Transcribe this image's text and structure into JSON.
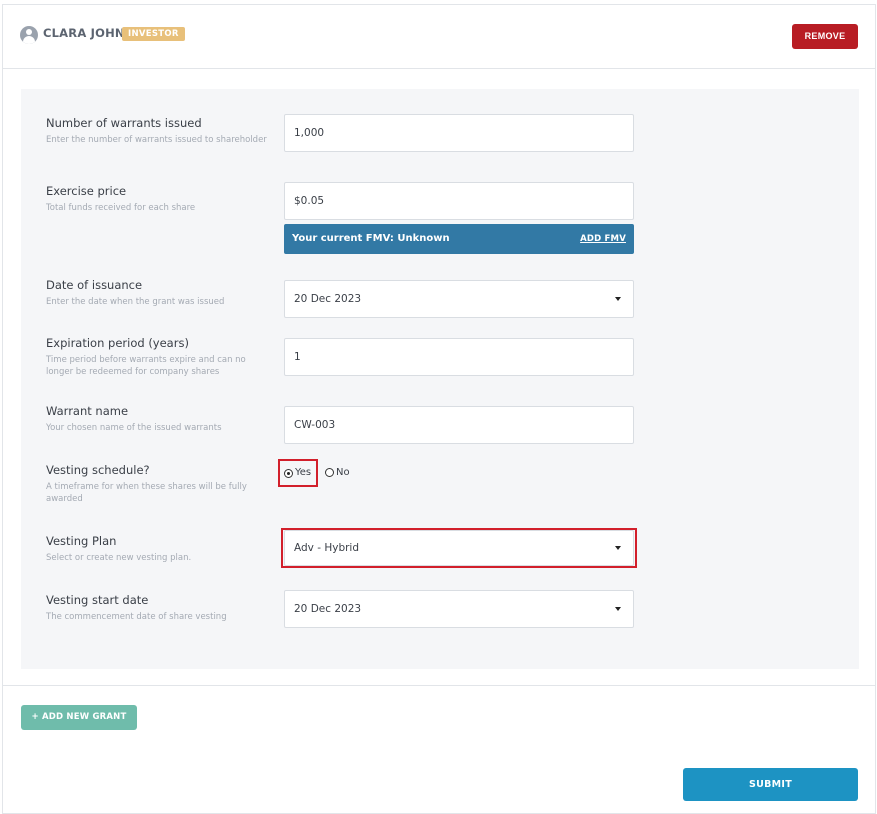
{
  "header": {
    "name": "CLARA JOHN",
    "badge": "INVESTOR",
    "remove_label": "REMOVE"
  },
  "form": {
    "warrants": {
      "label": "Number of warrants issued",
      "help": "Enter the number of warrants issued to shareholder",
      "value": "1,000"
    },
    "exercise_price": {
      "label": "Exercise price",
      "help": "Total funds received for each share",
      "value": "$0.05"
    },
    "fmv": {
      "text": "Your current FMV: Unknown",
      "link": "ADD FMV",
      "color": "#3279a5"
    },
    "date_of_issuance": {
      "label": "Date of issuance",
      "help": "Enter the date when the grant was issued",
      "value": "20 Dec 2023"
    },
    "expiration": {
      "label": "Expiration period (years)",
      "help": "Time period before warrants expire and can no longer be redeemed for company shares",
      "value": "1"
    },
    "warrant_name": {
      "label": "Warrant name",
      "help": "Your chosen name of the issued warrants",
      "value": "CW-003"
    },
    "vesting_schedule": {
      "label": "Vesting schedule?",
      "help": "A timeframe for when these shares will be fully awarded",
      "yes_label": "Yes",
      "no_label": "No",
      "selected": "Yes"
    },
    "vesting_plan": {
      "label": "Vesting Plan",
      "help": "Select or create new vesting plan.",
      "value": "Adv - Hybrid"
    },
    "vesting_start": {
      "label": "Vesting start date",
      "help": "The commencement date of share vesting",
      "value": "20 Dec 2023"
    }
  },
  "actions": {
    "add_grant_label": "+ ADD NEW GRANT",
    "submit_label": "SUBMIT"
  },
  "colors": {
    "remove": "#b81d24",
    "badge": "#e8c07a",
    "add_grant": "#6fbcab",
    "submit": "#1d93c3",
    "highlight": "#d21f2b"
  }
}
